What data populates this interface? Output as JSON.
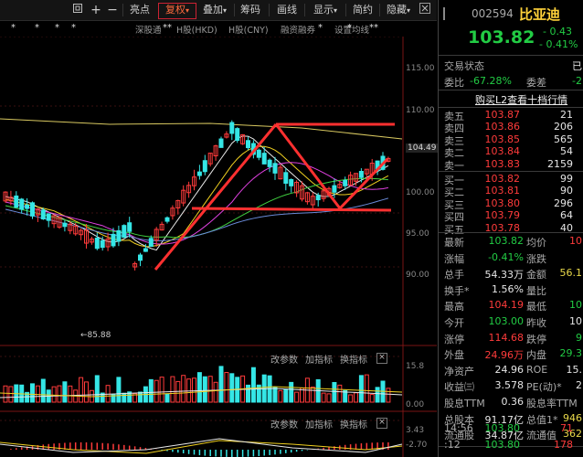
{
  "toolbar": {
    "buttons": [
      "亮点",
      "复权",
      "叠加",
      "筹码",
      "画线",
      "显示",
      "简约",
      "隐藏"
    ],
    "active_index": 1,
    "icons": [
      "fullscreen-icon",
      "add-icon",
      "minus-icon",
      "close-icon"
    ]
  },
  "tabs": {
    "items": [
      "深股通",
      "H股(HKD)",
      "H股(CNY)",
      "融资融券",
      "设置均线"
    ],
    "star_marks": [
      "*",
      "*",
      "*",
      "*",
      "*",
      "**",
      "**",
      "*",
      "*",
      "**"
    ]
  },
  "price_axis": [
    "115.00",
    "110.00",
    "104.49",
    "100.00",
    "95.00",
    "90.00"
  ],
  "low_marker": "85.88",
  "indicator1": {
    "labels": [
      "改参数",
      "加指标",
      "换指标"
    ],
    "axis": [
      "15.8",
      "0.00"
    ]
  },
  "indicator2": {
    "labels": [
      "改参数",
      "加指标",
      "换指标"
    ],
    "axis": [
      "3.43",
      "-2.70"
    ]
  },
  "stock": {
    "code": "002594",
    "name": "比亚迪",
    "price": "103.82",
    "change": "- 0.43",
    "change_pct": "- 0.41%"
  },
  "status": {
    "label": "交易状态",
    "value": "已"
  },
  "ratio": {
    "wb_label": "委比",
    "wb_value": "-67.28%",
    "wc_label": "委差",
    "wc_value": "-2"
  },
  "l2_banner": "购买L2查看十档行情",
  "asks": [
    {
      "label": "卖五",
      "price": "103.87",
      "vol": "21"
    },
    {
      "label": "卖四",
      "price": "103.86",
      "vol": "206"
    },
    {
      "label": "卖三",
      "price": "103.85",
      "vol": "565"
    },
    {
      "label": "卖二",
      "price": "103.84",
      "vol": "54"
    },
    {
      "label": "卖一",
      "price": "103.83",
      "vol": "2159"
    }
  ],
  "bids": [
    {
      "label": "买一",
      "price": "103.82",
      "vol": "99"
    },
    {
      "label": "买二",
      "price": "103.81",
      "vol": "90"
    },
    {
      "label": "买三",
      "price": "103.80",
      "vol": "296"
    },
    {
      "label": "买四",
      "price": "103.79",
      "vol": "64"
    },
    {
      "label": "买五",
      "price": "103.78",
      "vol": "40"
    }
  ],
  "stats": [
    {
      "k1": "最新",
      "v1": "103.82",
      "c1": "green",
      "k2": "均价",
      "v2": "10",
      "c2": "red"
    },
    {
      "k1": "涨幅",
      "v1": "-0.41%",
      "c1": "green",
      "k2": "涨跌",
      "v2": "",
      "c2": "green"
    },
    {
      "k1": "总手",
      "v1": "54.33万",
      "c1": "white",
      "k2": "金额",
      "v2": "56.1",
      "c2": "yellow"
    },
    {
      "k1": "换手*",
      "v1": "1.56%",
      "c1": "white",
      "k2": "量比",
      "v2": "",
      "c2": "white"
    },
    {
      "k1": "最高",
      "v1": "104.19",
      "c1": "red",
      "k2": "最低",
      "v2": "10",
      "c2": "green"
    },
    {
      "k1": "今开",
      "v1": "103.00",
      "c1": "green",
      "k2": "昨收",
      "v2": "10",
      "c2": "white"
    },
    {
      "k1": "涨停",
      "v1": "114.68",
      "c1": "red",
      "k2": "跌停",
      "v2": "9",
      "c2": "green"
    },
    {
      "k1": "外盘",
      "v1": "24.96万",
      "c1": "red",
      "k2": "内盘",
      "v2": "29.3",
      "c2": "green"
    },
    {
      "k1": "净资产",
      "v1": "24.96",
      "c1": "white",
      "k2": "ROE",
      "v2": "15.",
      "c2": "white"
    },
    {
      "k1": "收益㈢",
      "v1": "3.578",
      "c1": "white",
      "k2": "PE(动)*",
      "v2": "2",
      "c2": "white"
    },
    {
      "k1": "股息TTM",
      "v1": "0.36",
      "c1": "white",
      "k2": "股息率TTM",
      "v2": "",
      "c2": "white"
    },
    {
      "k1": "总股本",
      "v1": "91.17亿",
      "c1": "white",
      "k2": "总值1*",
      "v2": "946",
      "c2": "yellow"
    },
    {
      "k1": "流通股",
      "v1": "34.87亿",
      "c1": "white",
      "k2": "流通值",
      "v2": "362",
      "c2": "yellow"
    }
  ],
  "ticks": [
    {
      "time": "14:56",
      "price": "103.80",
      "vol": "71"
    },
    {
      "time": ":12",
      "price": "103.80",
      "vol": "178"
    }
  ]
}
